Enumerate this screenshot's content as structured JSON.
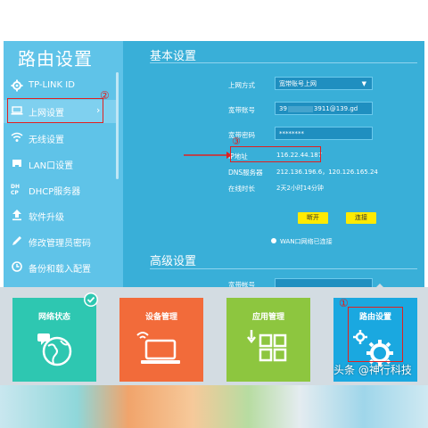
{
  "sidebar": {
    "title": "路由设置",
    "items": [
      {
        "label": "TP-LINK ID",
        "icon": "gear-icon"
      },
      {
        "label": "上网设置",
        "icon": "laptop-icon",
        "arrow": "›"
      },
      {
        "label": "无线设置",
        "icon": "wifi-icon"
      },
      {
        "label": "LAN口设置",
        "icon": "lan-icon"
      },
      {
        "label": "DHCP服务器",
        "icon": "dhcp-icon"
      },
      {
        "label": "软件升级",
        "icon": "upload-icon"
      },
      {
        "label": "修改管理员密码",
        "icon": "pencil-icon"
      },
      {
        "label": "备份和载入配置",
        "icon": "backup-icon"
      }
    ]
  },
  "basic": {
    "title": "基本设置",
    "mode_label": "上网方式",
    "mode_value": "宽带账号上网",
    "account_label": "宽带账号",
    "account_prefix": "39",
    "account_suffix": "3911@139.gd",
    "password_label": "宽带密码",
    "password_value": "********",
    "ip_label": "IP地址",
    "ip_value": "116.22.44.187",
    "dns_label": "DNS服务器",
    "dns_value": "212.136.196.6，120.126.165.24",
    "uptime_label": "在线时长",
    "uptime_value": "2天2小时14分钟",
    "connect_button": "断开",
    "link_button": "连接",
    "wan_status": "WAN口网络已连接"
  },
  "advanced": {
    "title": "高级设置",
    "row_label": "宽带帐号"
  },
  "annotations": {
    "n1": "①",
    "n2": "②",
    "n3": "③"
  },
  "tiles": [
    {
      "label": "网络状态",
      "color": "#2ec7b1"
    },
    {
      "label": "设备管理",
      "color": "#f26b3a"
    },
    {
      "label": "应用管理",
      "color": "#8dc63f"
    },
    {
      "label": "路由设置",
      "color": "#1aa8e0"
    }
  ],
  "watermark": "头条 @神行科技",
  "colors": {
    "sidebar": "#5fc3e8",
    "content": "#39afd8",
    "accent_yellow": "#ffea00",
    "annotation_red": "#e02020"
  }
}
